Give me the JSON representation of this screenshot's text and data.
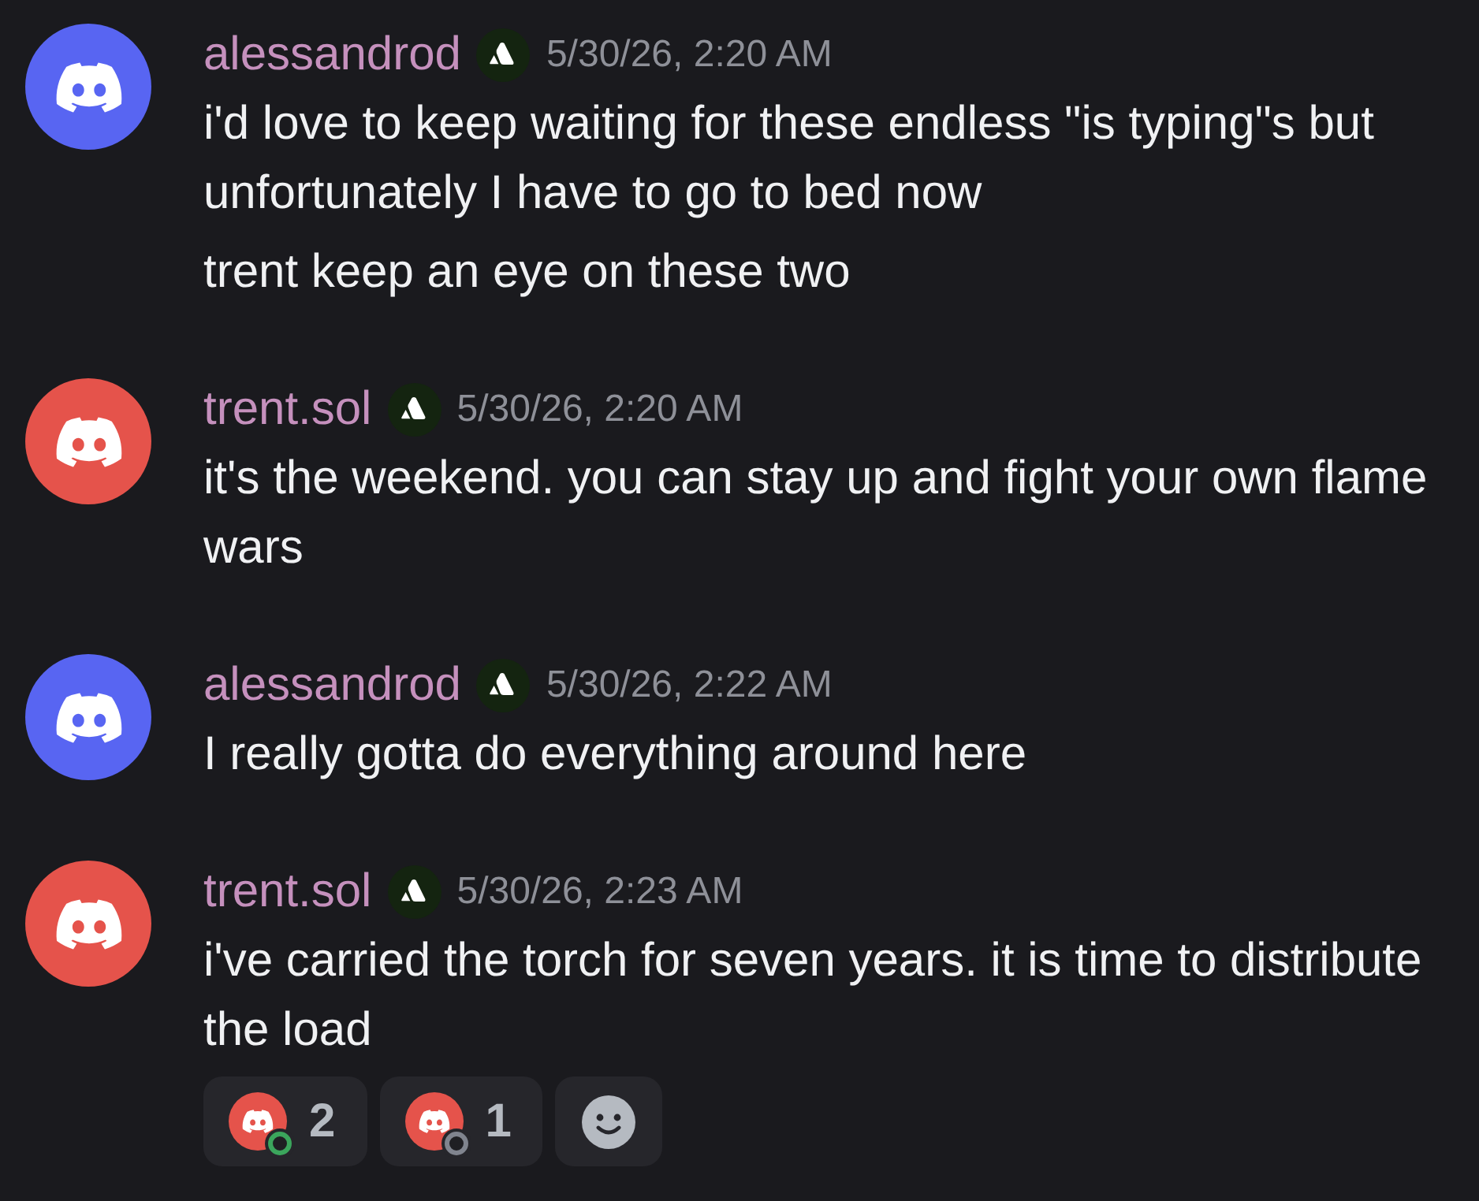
{
  "messages": [
    {
      "author": "alessandrod",
      "color": "#5865f2",
      "timestamp": "5/30/26, 2:20 AM",
      "paragraphs": [
        "i'd love to keep waiting for these endless \"is typing\"s but unfortunately I have to go to bed now",
        "trent keep an eye on these two"
      ]
    },
    {
      "author": "trent.sol",
      "color": "#e5534b",
      "timestamp": "5/30/26, 2:20 AM",
      "paragraphs": [
        "it's the weekend. you can stay up and fight your own flame wars"
      ]
    },
    {
      "author": "alessandrod",
      "color": "#5865f2",
      "timestamp": "5/30/26, 2:22 AM",
      "paragraphs": [
        "I really gotta do everything around here"
      ]
    },
    {
      "author": "trent.sol",
      "color": "#e5534b",
      "timestamp": "5/30/26, 2:23 AM",
      "paragraphs": [
        "i've carried the torch for seven years. it is time to distribute the load"
      ],
      "reactions": [
        {
          "count": "2",
          "online": true
        },
        {
          "count": "1",
          "online": false
        }
      ]
    }
  ]
}
